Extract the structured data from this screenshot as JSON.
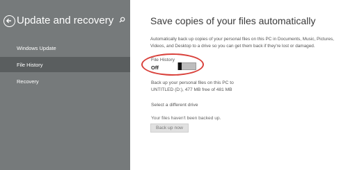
{
  "sidebar": {
    "title": "Update and recovery",
    "items": [
      {
        "label": "Windows Update",
        "selected": false
      },
      {
        "label": "File History",
        "selected": true
      },
      {
        "label": "Recovery",
        "selected": false
      }
    ]
  },
  "main": {
    "title": "Save copies of your files automatically",
    "description_line1": "Automatically back up copies of your personal files on this PC in Documents, Music, Pictures,",
    "description_line2": "Videos, and Desktop to a drive so you can get them back if they're lost or damaged.",
    "file_history_label": "File History",
    "toggle_state": "Off",
    "backup_info_line1": "Back up your personal files on this PC to",
    "backup_info_line2": "UNTITLED (D:), 477 MB free of 481 MB",
    "select_drive_link": "Select a different drive",
    "status_text": "Your files haven't been backed up.",
    "backup_button": "Back up now"
  },
  "colors": {
    "sidebar_bg": "#767a7b",
    "sidebar_selected": "#5a5e5f",
    "highlight_ring": "#d9403a"
  },
  "icons": {
    "back": "back-arrow-icon",
    "search": "search-icon"
  }
}
